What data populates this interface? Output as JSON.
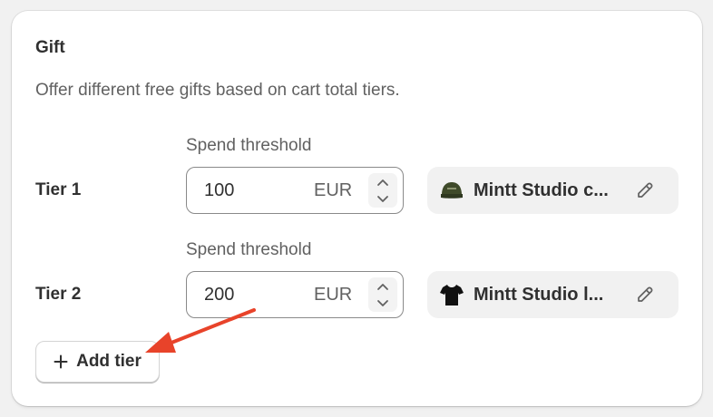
{
  "card": {
    "title": "Gift",
    "description": "Offer different free gifts based on cart total tiers."
  },
  "tiers": [
    {
      "label": "Tier 1",
      "threshold_label": "Spend threshold",
      "value": "100",
      "currency": "EUR",
      "gift_name": "Mintt Studio c...",
      "gift_icon": "cap-icon"
    },
    {
      "label": "Tier 2",
      "threshold_label": "Spend threshold",
      "value": "200",
      "currency": "EUR",
      "gift_name": "Mintt Studio l...",
      "gift_icon": "tshirt-icon"
    }
  ],
  "add_tier_button": {
    "label": "Add tier",
    "icon": "plus-icon"
  },
  "annotation": {
    "arrow_color": "#e8432a"
  }
}
